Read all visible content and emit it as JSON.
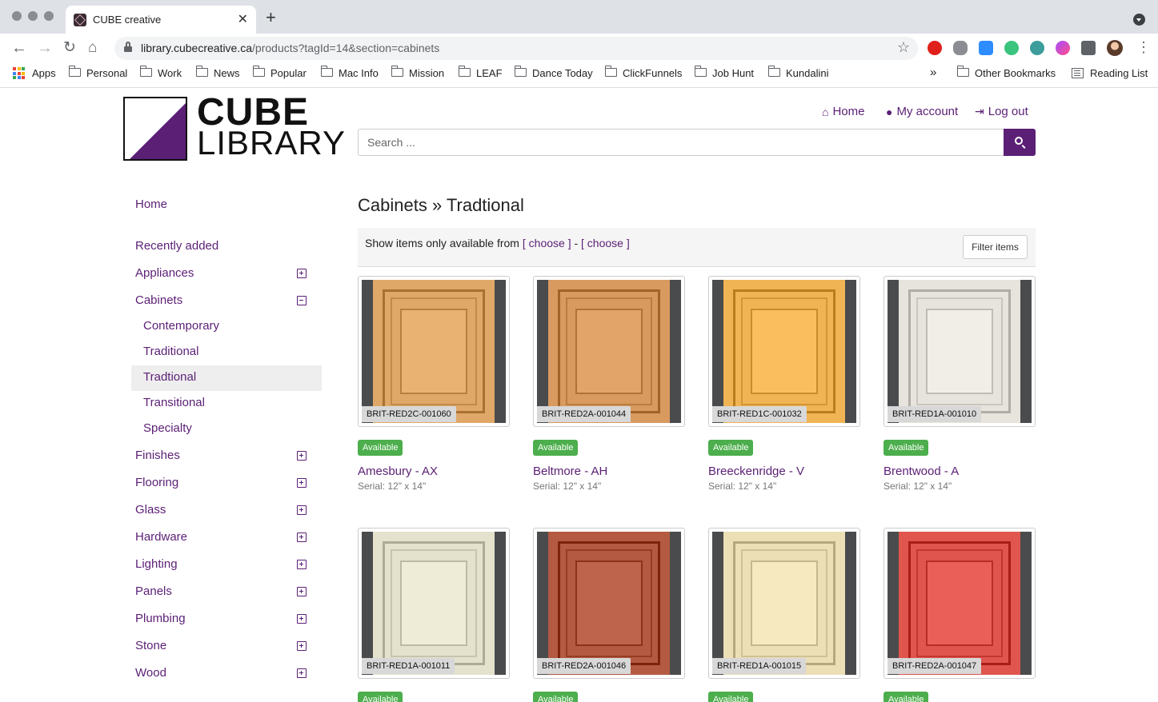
{
  "browser": {
    "tab_title": "CUBE creative",
    "url_host": "library.cubecreative.ca",
    "url_path": "/products?tagId=14&section=cabinets",
    "bookmarks": [
      "Apps",
      "Personal",
      "Work",
      "News",
      "Popular",
      "Mac Info",
      "Mission",
      "LEAF",
      "Dance Today",
      "ClickFunnels",
      "Job Hunt",
      "Kundalini"
    ],
    "overflow": "»",
    "other_bookmarks": "Other Bookmarks",
    "reading_list": "Reading List"
  },
  "logo": {
    "line1": "CUBE",
    "line2": "LIBRARY"
  },
  "topnav": {
    "home": "Home",
    "account": "My account",
    "logout": "Log out"
  },
  "search": {
    "placeholder": "Search ..."
  },
  "sidebar": {
    "home": "Home",
    "recently_added": "Recently added",
    "appliances": "Appliances",
    "cabinets": "Cabinets",
    "cabinets_sub": [
      "Contemporary",
      "Traditional",
      "Tradtional",
      "Transitional",
      "Specialty"
    ],
    "rest": [
      "Finishes",
      "Flooring",
      "Glass",
      "Hardware",
      "Lighting",
      "Panels",
      "Plumbing",
      "Stone",
      "Wood"
    ]
  },
  "main": {
    "title": "Cabinets » Tradtional",
    "filter": {
      "prefix": "Show items only available from",
      "choose1": "[ choose ]",
      "dash": "-",
      "choose2": "[ choose ]",
      "button": "Filter items"
    },
    "products": [
      {
        "sku": "BRIT-RED2C-001060",
        "status": "Available",
        "name": "Amesbury - AX",
        "serial": "Serial: 12\" x 14\"",
        "color": "#e0a868"
      },
      {
        "sku": "BRIT-RED2A-001044",
        "status": "Available",
        "name": "Beltmore - AH",
        "serial": "Serial: 12\" x 14\"",
        "color": "#d99a60"
      },
      {
        "sku": "BRIT-RED1C-001032",
        "status": "Available",
        "name": "Breeckenridge - V",
        "serial": "Serial: 12\" x 14\"",
        "color": "#f0b455"
      },
      {
        "sku": "BRIT-RED1A-001010",
        "status": "Available",
        "name": "Brentwood - A",
        "serial": "Serial: 12\" x 14\"",
        "color": "#e6e4dc"
      },
      {
        "sku": "BRIT-RED1A-001011",
        "status": "Available",
        "color": "#e4e2cc"
      },
      {
        "sku": "BRIT-RED2A-001046",
        "status": "Available",
        "color": "#b45a42"
      },
      {
        "sku": "BRIT-RED1A-001015",
        "status": "Available",
        "color": "#ecdfb6"
      },
      {
        "sku": "BRIT-RED2A-001047",
        "status": "Available",
        "color": "#e0554d"
      }
    ]
  },
  "colors": {
    "brand": "#5b1f75",
    "available": "#4cae4c"
  }
}
